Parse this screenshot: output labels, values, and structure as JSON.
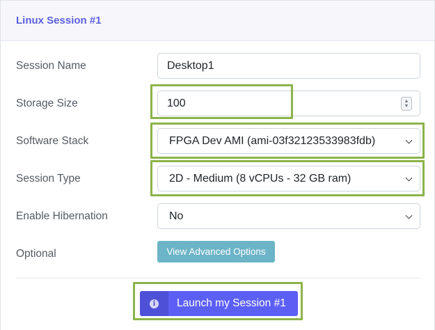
{
  "card": {
    "title": "Linux Session #1"
  },
  "fields": {
    "session_name": {
      "label": "Session Name",
      "value": "Desktop1"
    },
    "storage_size": {
      "label": "Storage Size",
      "value": "100"
    },
    "software_stack": {
      "label": "Software Stack",
      "value": "FPGA Dev AMI (ami-03f32123533983fdb)"
    },
    "session_type": {
      "label": "Session Type",
      "value": "2D - Medium (8 vCPUs - 32 GB ram)"
    },
    "enable_hibernation": {
      "label": "Enable Hibernation",
      "value": "No"
    },
    "optional": {
      "label": "Optional"
    }
  },
  "buttons": {
    "advanced_label": "View Advanced Options",
    "launch_label": "Launch my Session #1"
  },
  "icons": {
    "stepper": "stepper-icon",
    "select": "chevron-down-icon",
    "launch": "info-icon"
  },
  "colors": {
    "accent": "#5c5ff4",
    "title": "#5b5fe0",
    "advanced_button": "#6cb4c7",
    "highlight": "#8cb34a"
  }
}
